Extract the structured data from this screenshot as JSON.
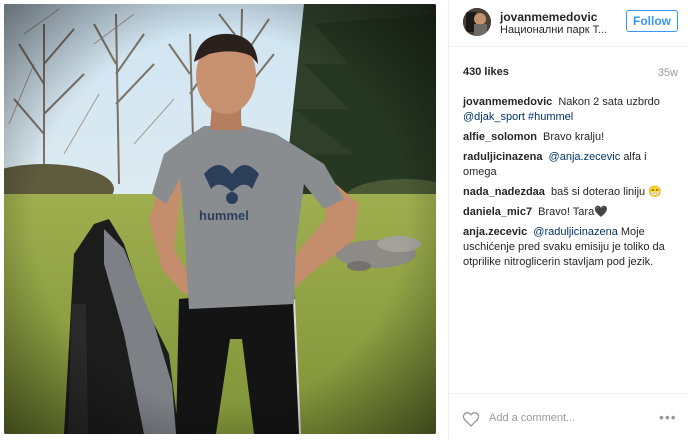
{
  "post": {
    "username": "jovanmemedovic",
    "location": "Национални парк Т...",
    "follow_label": "Follow",
    "likes": "430 likes",
    "time": "35w",
    "add_comment_placeholder": "Add a comment...",
    "more_label": "•••",
    "photo_shirt_text": "hummel",
    "caption": {
      "user": "jovanmemedovic",
      "text": "Nakon 2 sata uzbrdo",
      "mention": "@djak_sport",
      "hashtag": "#hummel"
    },
    "comments": [
      {
        "user": "alfie_solomon",
        "text": "Bravo kralju!"
      },
      {
        "user": "raduljicinazena",
        "mention": "@anja.zecevic",
        "text": "alfa i omega"
      },
      {
        "user": "nada_nadezdaa",
        "text": "baš si doterao liniju",
        "emoji": "😁"
      },
      {
        "user": "daniela_mic7",
        "text": "Bravo! Tara",
        "emoji": "🖤"
      },
      {
        "user": "anja.zecevic",
        "mention": "@raduljicinazena",
        "text": "Moje uschićenje pred svaku emisiju je toliko da otprilike nitroglicerin stavljam pod jezik."
      }
    ]
  },
  "colors": {
    "accent": "#3897f0",
    "link": "#003569",
    "muted": "#999999",
    "border": "#efefef"
  },
  "icons": {
    "like": "heart-outline-icon",
    "more": "more-options-icon"
  }
}
